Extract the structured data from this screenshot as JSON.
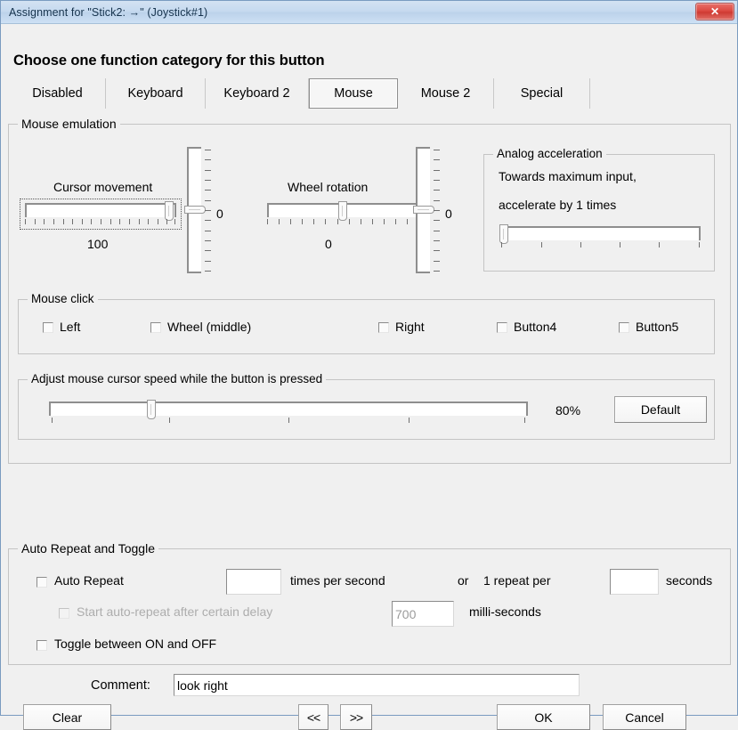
{
  "window": {
    "title": "Assignment for \"Stick2: →\" (Joystick#1)",
    "close_label": "✕"
  },
  "heading": "Choose one function category for this button",
  "tabs": [
    {
      "label": "Disabled",
      "selected": false
    },
    {
      "label": "Keyboard",
      "selected": false
    },
    {
      "label": "Keyboard 2",
      "selected": false
    },
    {
      "label": "Mouse",
      "selected": true
    },
    {
      "label": "Mouse 2",
      "selected": false
    },
    {
      "label": "Special",
      "selected": false
    }
  ],
  "mouse_emulation": {
    "legend": "Mouse emulation",
    "cursor_movement": {
      "label": "Cursor movement",
      "value": "100"
    },
    "cursor_vertical": {
      "value": "0"
    },
    "wheel_rotation": {
      "label": "Wheel rotation",
      "value": "0"
    },
    "wheel_vertical": {
      "value": "0"
    },
    "analog_acceleration": {
      "legend": "Analog acceleration",
      "line1": "Towards maximum input,",
      "line2": "accelerate by 1 times"
    }
  },
  "mouse_click": {
    "legend": "Mouse click",
    "items": [
      {
        "label": "Left",
        "checked": false
      },
      {
        "label": "Wheel (middle)",
        "checked": false
      },
      {
        "label": "Right",
        "checked": false
      },
      {
        "label": "Button4",
        "checked": false
      },
      {
        "label": "Button5",
        "checked": false
      }
    ]
  },
  "cursor_speed": {
    "legend": "Adjust mouse cursor speed while the button is pressed",
    "value": "80%",
    "default_label": "Default"
  },
  "auto_repeat": {
    "legend": "Auto Repeat and Toggle",
    "auto_repeat_label": "Auto Repeat",
    "rate_value": "",
    "times_per_second_label": "times per second",
    "or_label": "or",
    "one_repeat_per_label": "1 repeat per",
    "seconds_value": "",
    "seconds_label": "seconds",
    "delay_checkbox_label": "Start auto-repeat after certain delay",
    "delay_value": "700",
    "milliseconds_label": "milli-seconds",
    "toggle_label": "Toggle between ON and OFF"
  },
  "footer": {
    "comment_label": "Comment:",
    "comment_value": "look right",
    "comment_placeholder": "",
    "clear_label": "Clear",
    "prev_label": "<<",
    "next_label": ">>",
    "ok_label": "OK",
    "cancel_label": "Cancel"
  }
}
